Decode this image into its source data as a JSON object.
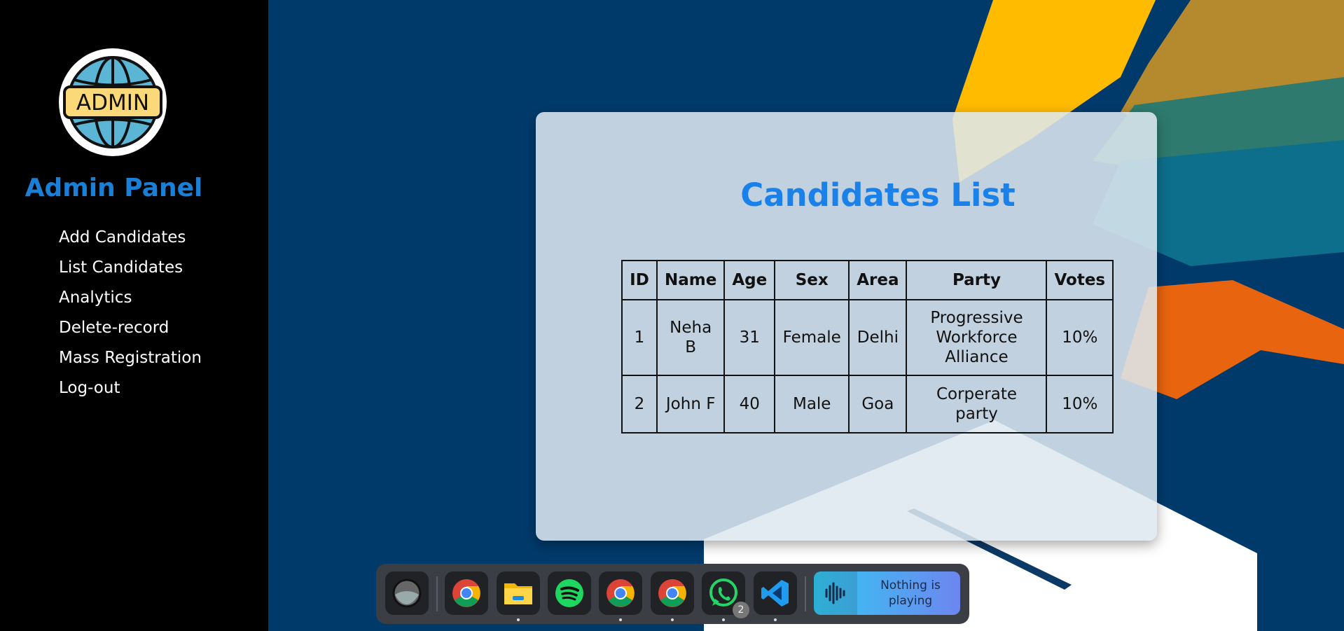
{
  "sidebar": {
    "logo_text": "ADMIN",
    "title": "Admin Panel",
    "items": [
      {
        "label": "Add Candidates"
      },
      {
        "label": "List Candidates"
      },
      {
        "label": "Analytics"
      },
      {
        "label": "Delete-record"
      },
      {
        "label": "Mass Registration"
      },
      {
        "label": "Log-out"
      }
    ]
  },
  "main": {
    "title": "Candidates List",
    "table": {
      "headers": [
        "ID",
        "Name",
        "Age",
        "Sex",
        "Area",
        "Party",
        "Votes"
      ],
      "rows": [
        [
          "1",
          "Neha B",
          "31",
          "Female",
          "Delhi",
          "Progressive Workforce Alliance",
          "10%"
        ],
        [
          "2",
          "John F",
          "40",
          "Male",
          "Goa",
          "Corperate party",
          "10%"
        ]
      ]
    }
  },
  "taskbar": {
    "apps": [
      {
        "icon": "system-orb-icon"
      },
      {
        "icon": "chrome-icon"
      },
      {
        "icon": "folder-icon"
      },
      {
        "icon": "spotify-icon"
      },
      {
        "icon": "chrome-icon"
      },
      {
        "icon": "chrome-icon"
      },
      {
        "icon": "whatsapp-icon",
        "badge": "2"
      },
      {
        "icon": "vscode-icon"
      }
    ],
    "media_text": "Nothing is playing"
  },
  "colors": {
    "background": "#003a6b",
    "sidebar_bg": "#000000",
    "sidebar_title": "#1a7fd6",
    "card_title": "#1a80ea",
    "accent_yellow": "#ffbb00",
    "accent_orange": "#e8640f",
    "accent_teal": "#0e6f8c"
  }
}
